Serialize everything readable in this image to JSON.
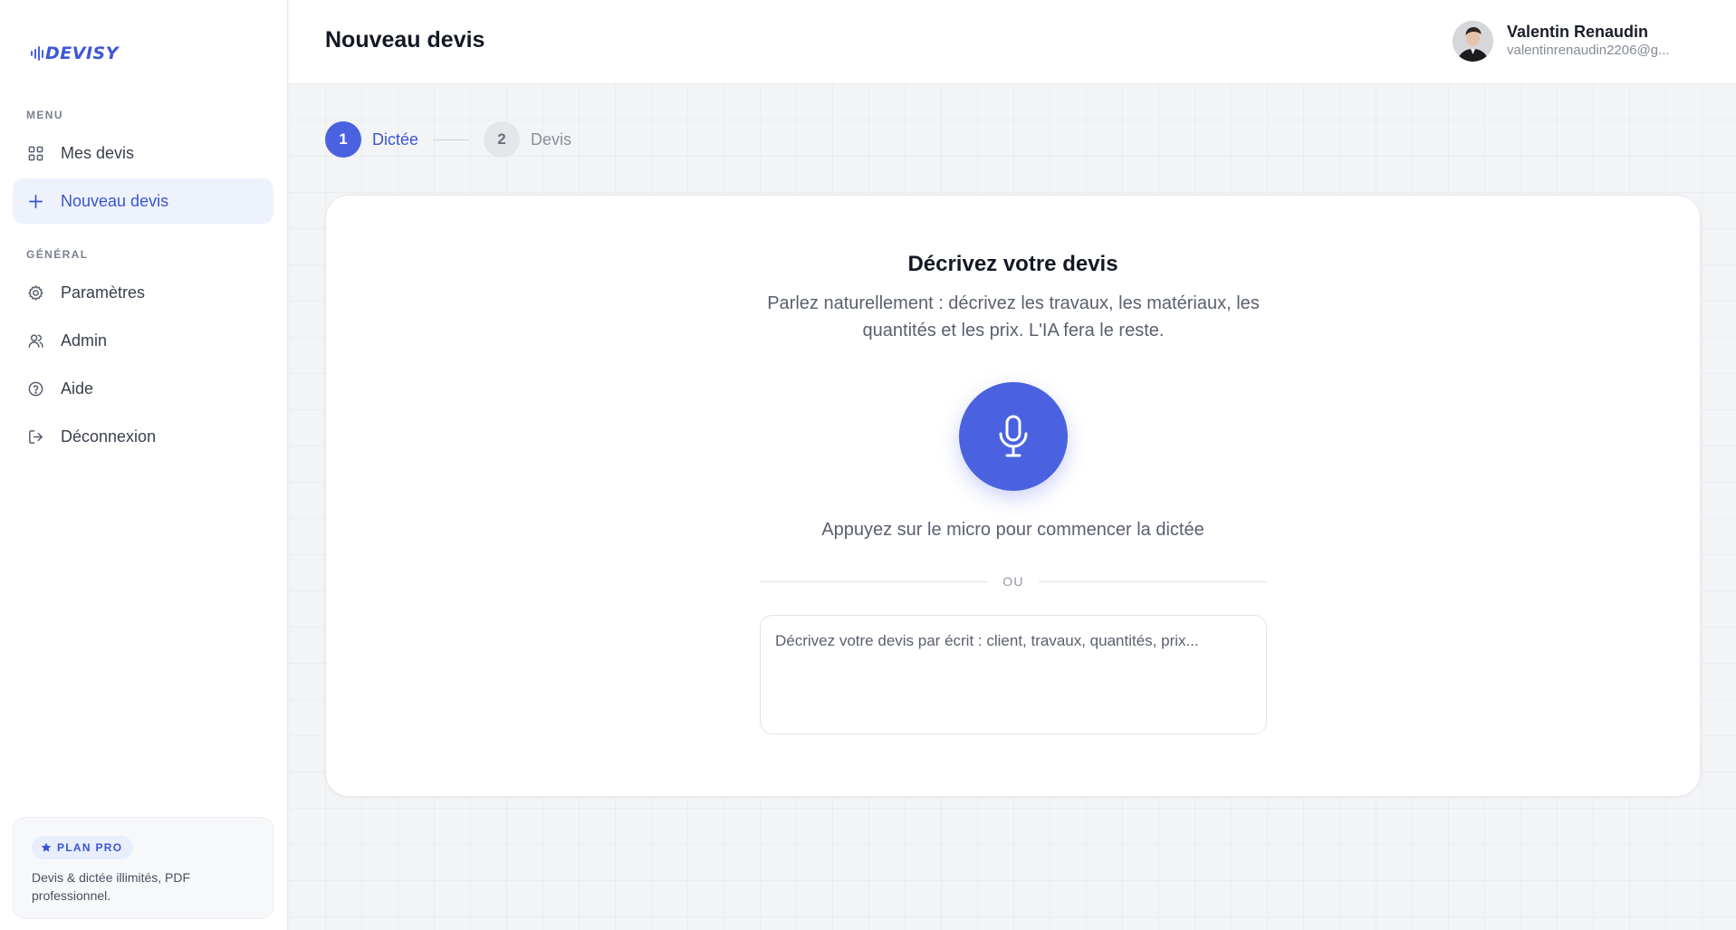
{
  "app": {
    "logo_text": "DEVISY"
  },
  "sidebar": {
    "menu_label": "MENU",
    "general_label": "GÉNÉRAL",
    "menu_items": [
      {
        "label": "Mes devis",
        "icon": "grid-icon"
      },
      {
        "label": "Nouveau devis",
        "icon": "plus-icon",
        "active": true
      }
    ],
    "general_items": [
      {
        "label": "Paramètres",
        "icon": "gear-icon"
      },
      {
        "label": "Admin",
        "icon": "users-icon"
      },
      {
        "label": "Aide",
        "icon": "help-circle-icon"
      },
      {
        "label": "Déconnexion",
        "icon": "logout-icon"
      }
    ],
    "plan": {
      "badge": "PLAN PRO",
      "description": "Devis & dictée illimités, PDF professionnel."
    }
  },
  "header": {
    "title": "Nouveau devis",
    "user": {
      "name": "Valentin Renaudin",
      "email": "valentinrenaudin2206@g..."
    }
  },
  "stepper": {
    "steps": [
      {
        "number": "1",
        "label": "Dictée",
        "active": true
      },
      {
        "number": "2",
        "label": "Devis",
        "active": false
      }
    ]
  },
  "card": {
    "title": "Décrivez votre devis",
    "subtitle": "Parlez naturellement : décrivez les travaux, les matériaux, les quantités et les prix. L'IA fera le reste.",
    "mic_hint": "Appuyez sur le micro pour commencer la dictée",
    "divider": "OU",
    "textarea_placeholder": "Décrivez votre devis par écrit : client, travaux, quantités, prix...",
    "textarea_value": ""
  },
  "colors": {
    "accent": "#4a62e0",
    "active_bg": "#edf2fd",
    "background": "#f3f4f6"
  }
}
